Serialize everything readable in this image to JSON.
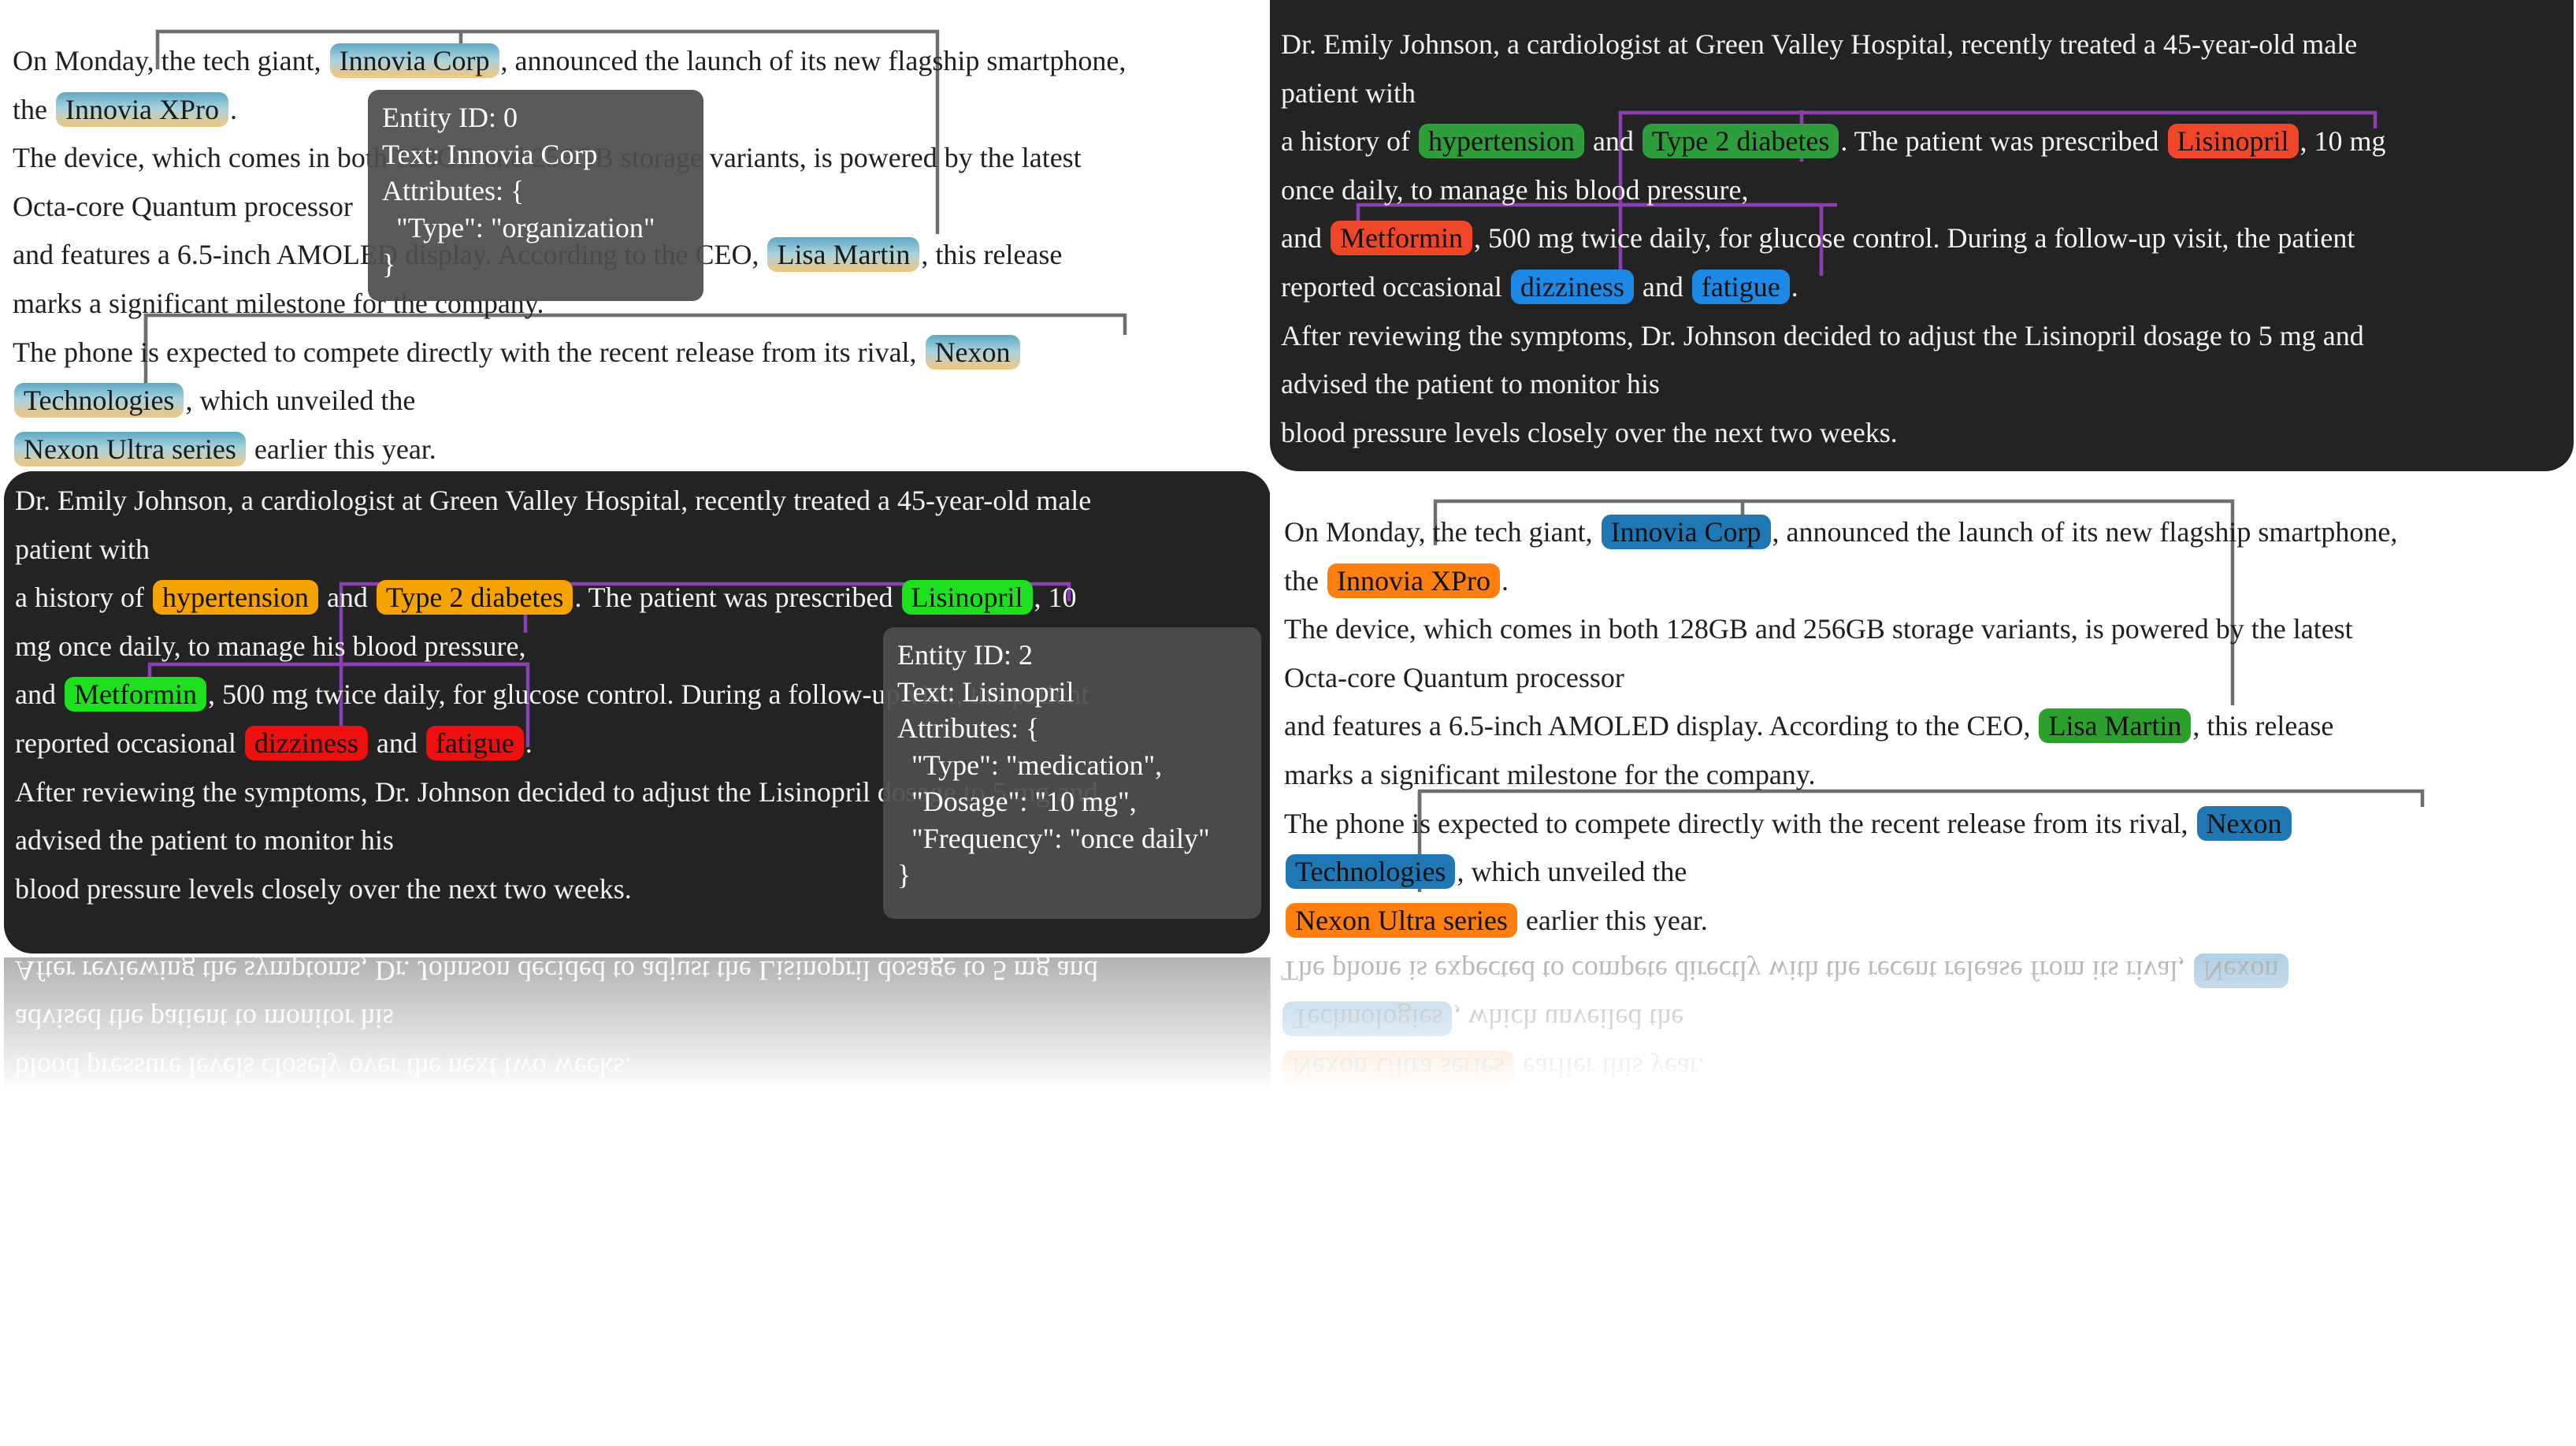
{
  "panels": [
    {
      "id": "p1",
      "theme": "light",
      "lines": [
        [
          {
            "t": "On Monday, the tech giant, "
          },
          {
            "t": "Innovia Corp",
            "c": "grad"
          },
          {
            "t": ", announced the launch of its new flagship smartphone,"
          }
        ],
        [
          {
            "t": "the "
          },
          {
            "t": "Innovia XPro",
            "c": "grad"
          },
          {
            "t": "."
          }
        ],
        [
          {
            "t": "The device, which comes in both 128GB and 256GB storage variants, is powered by the latest"
          }
        ],
        [
          {
            "t": "Octa-core Quantum processor"
          }
        ],
        [
          {
            "t": "and features a 6.5-inch AMOLED display. According to the CEO, "
          },
          {
            "t": "Lisa Martin",
            "c": "grad"
          },
          {
            "t": ", this release"
          }
        ],
        [
          {
            "t": "marks a significant milestone for the company."
          }
        ],
        [
          {
            "t": "The phone is expected to compete directly with the recent release from its rival, "
          },
          {
            "t": "Nexon",
            "c": "grad"
          }
        ],
        [
          {
            "t": "Technologies",
            "c": "grad"
          },
          {
            "t": ", which unveiled the"
          }
        ],
        [
          {
            "t": "Nexon Ultra series",
            "c": "grad"
          },
          {
            "t": " earlier this year."
          }
        ]
      ],
      "tooltip": "Entity ID: 0\nText: Innovia Corp\nAttributes: {\n  \"Type\": \"organization\"\n}"
    },
    {
      "id": "p2",
      "theme": "dark",
      "lines": [
        [
          {
            "t": "Dr. Emily Johnson, a cardiologist at Green Valley Hospital, recently treated a 45-year-old male"
          }
        ],
        [
          {
            "t": "patient with"
          }
        ],
        [
          {
            "t": "a history of "
          },
          {
            "t": "hypertension",
            "c": "#2e9e3c"
          },
          {
            "t": " and "
          },
          {
            "t": "Type 2 diabetes",
            "c": "#2e9e3c"
          },
          {
            "t": ". The patient was prescribed "
          },
          {
            "t": "Lisinopril",
            "c": "#f0462a"
          },
          {
            "t": ", 10 mg"
          }
        ],
        [
          {
            "t": "once daily, to manage his blood pressure,"
          }
        ],
        [
          {
            "t": "and "
          },
          {
            "t": "Metformin",
            "c": "#f0462a"
          },
          {
            "t": ", 500 mg twice daily, for glucose control. During a follow-up visit, the patient"
          }
        ],
        [
          {
            "t": "reported occasional "
          },
          {
            "t": "dizziness",
            "c": "#1e88e5"
          },
          {
            "t": " and "
          },
          {
            "t": "fatigue",
            "c": "#1e88e5"
          },
          {
            "t": "."
          }
        ],
        [
          {
            "t": "After reviewing the symptoms, Dr. Johnson decided to adjust the Lisinopril dosage to 5 mg and"
          }
        ],
        [
          {
            "t": "advised the patient to monitor his"
          }
        ],
        [
          {
            "t": "blood pressure levels closely over the next two weeks."
          }
        ]
      ]
    },
    {
      "id": "p3",
      "theme": "dark",
      "lines": [
        [
          {
            "t": "Dr. Emily Johnson, a cardiologist at Green Valley Hospital, recently treated a 45-year-old male"
          }
        ],
        [
          {
            "t": "patient with"
          }
        ],
        [
          {
            "t": "a history of "
          },
          {
            "t": "hypertension",
            "c": "#f5a300"
          },
          {
            "t": " and "
          },
          {
            "t": "Type 2 diabetes",
            "c": "#f5a300"
          },
          {
            "t": ". The patient was prescribed "
          },
          {
            "t": "Lisinopril",
            "c": "#1ee01e"
          },
          {
            "t": ", 10"
          }
        ],
        [
          {
            "t": "mg once daily, to manage his blood pressure,"
          }
        ],
        [
          {
            "t": "and "
          },
          {
            "t": "Metformin",
            "c": "#1ee01e"
          },
          {
            "t": ", 500 mg twice daily, for glucose control. During a follow-up visit, the patient"
          }
        ],
        [
          {
            "t": "reported occasional "
          },
          {
            "t": "dizziness",
            "c": "#ee0f0f"
          },
          {
            "t": " and "
          },
          {
            "t": "fatigue",
            "c": "#ee0f0f"
          },
          {
            "t": "."
          }
        ],
        [
          {
            "t": "After reviewing the symptoms, Dr. Johnson decided to adjust the Lisinopril dosage to 5 mg and"
          }
        ],
        [
          {
            "t": "advised the patient to monitor his"
          }
        ],
        [
          {
            "t": "blood pressure levels closely over the next two weeks."
          }
        ]
      ],
      "tooltip": "Entity ID: 2\nText: Lisinopril\nAttributes: {\n  \"Type\": \"medication\",\n  \"Dosage\": \"10 mg\",\n  \"Frequency\": \"once daily\"\n}"
    },
    {
      "id": "p4",
      "theme": "light",
      "lines": [
        [
          {
            "t": "On Monday, the tech giant, "
          },
          {
            "t": "Innovia Corp",
            "c": "#1f77b4"
          },
          {
            "t": ", announced the launch of its new flagship smartphone,"
          }
        ],
        [
          {
            "t": "the "
          },
          {
            "t": "Innovia XPro",
            "c": "#ff7f0e"
          },
          {
            "t": "."
          }
        ],
        [
          {
            "t": "The device, which comes in both 128GB and 256GB storage variants, is powered by the latest"
          }
        ],
        [
          {
            "t": "Octa-core Quantum processor"
          }
        ],
        [
          {
            "t": "and features a 6.5-inch AMOLED display. According to the CEO, "
          },
          {
            "t": "Lisa Martin",
            "c": "#2ca02c"
          },
          {
            "t": ", this release"
          }
        ],
        [
          {
            "t": "marks a significant milestone for the company."
          }
        ],
        [
          {
            "t": "The phone is expected to compete directly with the recent release from its rival, "
          },
          {
            "t": "Nexon",
            "c": "#1f77b4"
          }
        ],
        [
          {
            "t": "Technologies",
            "c": "#1f77b4"
          },
          {
            "t": ", which unveiled the"
          }
        ],
        [
          {
            "t": "Nexon Ultra series",
            "c": "#ff7f0e"
          },
          {
            "t": " earlier this year."
          }
        ]
      ]
    }
  ],
  "colors": {
    "page_bg": "#ffffff",
    "dark_panel_bg": "#232323",
    "link_gray": "#6f6f6f",
    "link_purple": "#8b3fb0",
    "tooltip_bg": "#4e4e4e"
  }
}
